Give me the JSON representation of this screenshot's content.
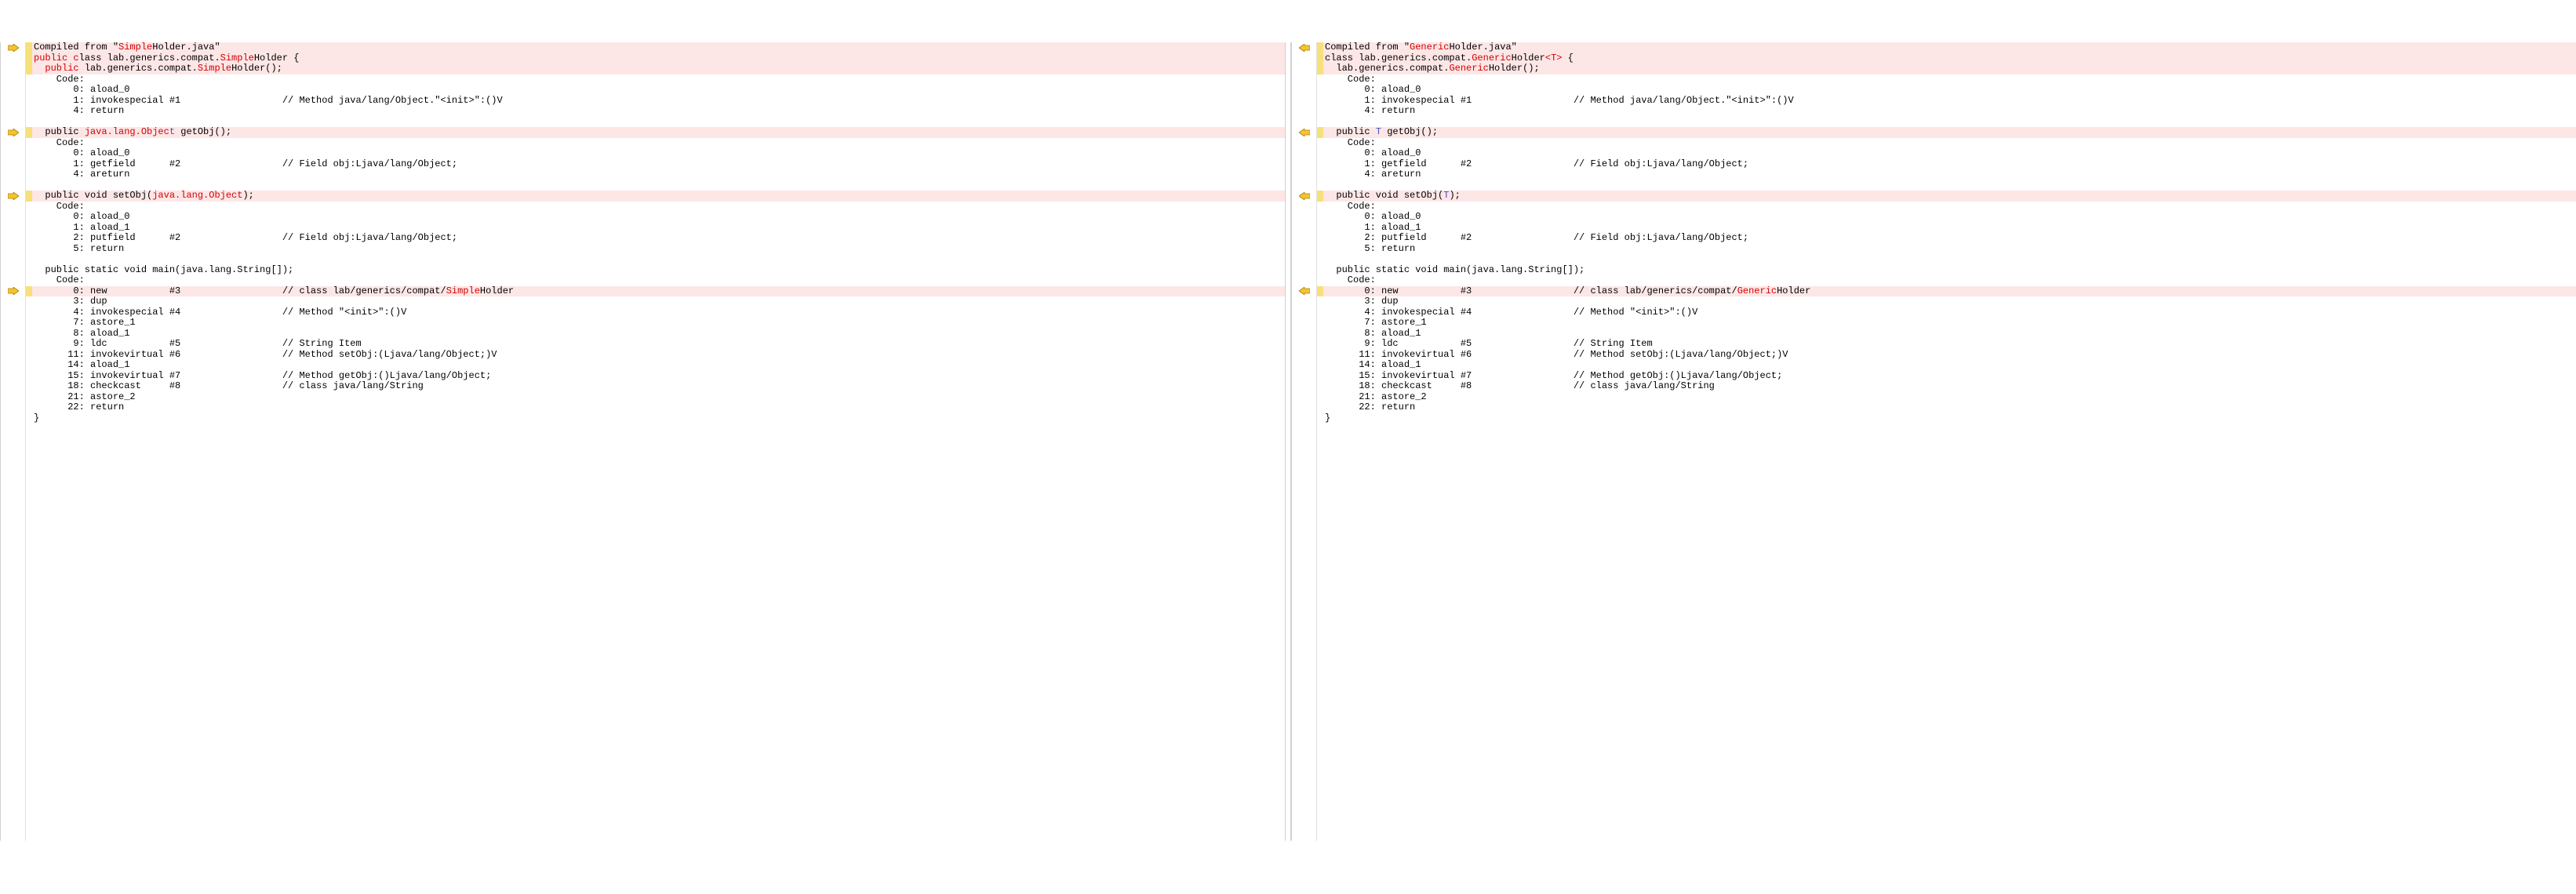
{
  "left": {
    "lines": [
      {
        "changed": true,
        "arrow": "right",
        "tokens": [
          [
            "",
            "Compiled from \""
          ],
          [
            "diff",
            "Simple"
          ],
          [
            "",
            "Holder.java\""
          ]
        ]
      },
      {
        "changed": true,
        "arrow": "",
        "tokens": [
          [
            "diff",
            "public c"
          ],
          [
            "",
            "lass lab.generics.compat."
          ],
          [
            "diff",
            "Simple"
          ],
          [
            "",
            "Holder {"
          ]
        ]
      },
      {
        "changed": true,
        "arrow": "",
        "tokens": [
          [
            "",
            "  "
          ],
          [
            "diff",
            "public "
          ],
          [
            "",
            "lab.generics.compat."
          ],
          [
            "diff",
            "Simple"
          ],
          [
            "",
            "Holder();"
          ]
        ]
      },
      {
        "changed": false,
        "arrow": "",
        "tokens": [
          [
            "",
            "    Code:"
          ]
        ]
      },
      {
        "changed": false,
        "arrow": "",
        "tokens": [
          [
            "",
            "       0: aload_0"
          ]
        ]
      },
      {
        "changed": false,
        "arrow": "",
        "tokens": [
          [
            "",
            "       1: invokespecial #1                  // Method java/lang/Object.\"<init>\":()V"
          ]
        ]
      },
      {
        "changed": false,
        "arrow": "",
        "tokens": [
          [
            "",
            "       4: return"
          ]
        ]
      },
      {
        "changed": false,
        "arrow": "",
        "tokens": [
          [
            "",
            ""
          ]
        ]
      },
      {
        "changed": true,
        "arrow": "right",
        "tokens": [
          [
            "",
            "  public "
          ],
          [
            "diff",
            "java.lang.Objec"
          ],
          [
            "kw",
            "t"
          ],
          [
            "",
            " getObj();"
          ]
        ]
      },
      {
        "changed": false,
        "arrow": "",
        "tokens": [
          [
            "",
            "    Code:"
          ]
        ]
      },
      {
        "changed": false,
        "arrow": "",
        "tokens": [
          [
            "",
            "       0: aload_0"
          ]
        ]
      },
      {
        "changed": false,
        "arrow": "",
        "tokens": [
          [
            "",
            "       1: getfield      #2                  // Field obj:Ljava/lang/Object;"
          ]
        ]
      },
      {
        "changed": false,
        "arrow": "",
        "tokens": [
          [
            "",
            "       4: areturn"
          ]
        ]
      },
      {
        "changed": false,
        "arrow": "",
        "tokens": [
          [
            "",
            ""
          ]
        ]
      },
      {
        "changed": true,
        "arrow": "right",
        "tokens": [
          [
            "",
            "  public void setObj("
          ],
          [
            "diff",
            "java.lang.Object"
          ],
          [
            "",
            ");"
          ]
        ]
      },
      {
        "changed": false,
        "arrow": "",
        "tokens": [
          [
            "",
            "    Code:"
          ]
        ]
      },
      {
        "changed": false,
        "arrow": "",
        "tokens": [
          [
            "",
            "       0: aload_0"
          ]
        ]
      },
      {
        "changed": false,
        "arrow": "",
        "tokens": [
          [
            "",
            "       1: aload_1"
          ]
        ]
      },
      {
        "changed": false,
        "arrow": "",
        "tokens": [
          [
            "",
            "       2: putfield      #2                  // Field obj:Ljava/lang/Object;"
          ]
        ]
      },
      {
        "changed": false,
        "arrow": "",
        "tokens": [
          [
            "",
            "       5: return"
          ]
        ]
      },
      {
        "changed": false,
        "arrow": "",
        "tokens": [
          [
            "",
            ""
          ]
        ]
      },
      {
        "changed": false,
        "arrow": "",
        "tokens": [
          [
            "",
            "  public static void main(java.lang.String[]);"
          ]
        ]
      },
      {
        "changed": false,
        "arrow": "",
        "tokens": [
          [
            "",
            "    Code:"
          ]
        ]
      },
      {
        "changed": true,
        "arrow": "right",
        "tokens": [
          [
            "",
            "       0: new           #3                  // class lab/generics/compat/"
          ],
          [
            "diff",
            "Simple"
          ],
          [
            "",
            "Holder"
          ]
        ]
      },
      {
        "changed": false,
        "arrow": "",
        "tokens": [
          [
            "",
            "       3: dup"
          ]
        ]
      },
      {
        "changed": false,
        "arrow": "",
        "tokens": [
          [
            "",
            "       4: invokespecial #4                  // Method \"<init>\":()V"
          ]
        ]
      },
      {
        "changed": false,
        "arrow": "",
        "tokens": [
          [
            "",
            "       7: astore_1"
          ]
        ]
      },
      {
        "changed": false,
        "arrow": "",
        "tokens": [
          [
            "",
            "       8: aload_1"
          ]
        ]
      },
      {
        "changed": false,
        "arrow": "",
        "tokens": [
          [
            "",
            "       9: ldc           #5                  // String Item"
          ]
        ]
      },
      {
        "changed": false,
        "arrow": "",
        "tokens": [
          [
            "",
            "      11: invokevirtual #6                  // Method setObj:(Ljava/lang/Object;)V"
          ]
        ]
      },
      {
        "changed": false,
        "arrow": "",
        "tokens": [
          [
            "",
            "      14: aload_1"
          ]
        ]
      },
      {
        "changed": false,
        "arrow": "",
        "tokens": [
          [
            "",
            "      15: invokevirtual #7                  // Method getObj:()Ljava/lang/Object;"
          ]
        ]
      },
      {
        "changed": false,
        "arrow": "",
        "tokens": [
          [
            "",
            "      18: checkcast     #8                  // class java/lang/String"
          ]
        ]
      },
      {
        "changed": false,
        "arrow": "",
        "tokens": [
          [
            "",
            "      21: astore_2"
          ]
        ]
      },
      {
        "changed": false,
        "arrow": "",
        "tokens": [
          [
            "",
            "      22: return"
          ]
        ]
      },
      {
        "changed": false,
        "arrow": "",
        "tokens": [
          [
            "",
            "}"
          ]
        ]
      }
    ]
  },
  "right": {
    "lines": [
      {
        "changed": true,
        "arrow": "left",
        "tokens": [
          [
            "",
            "Compiled from \""
          ],
          [
            "diff",
            "Generic"
          ],
          [
            "",
            "Holder.java\""
          ]
        ]
      },
      {
        "changed": true,
        "arrow": "",
        "tokens": [
          [
            "",
            "class lab.generics.compat."
          ],
          [
            "diff",
            "Generic"
          ],
          [
            "",
            "Holder"
          ],
          [
            "diff",
            "<T>"
          ],
          [
            "",
            " {"
          ]
        ]
      },
      {
        "changed": true,
        "arrow": "",
        "tokens": [
          [
            "",
            "  lab.generics.compat."
          ],
          [
            "diff",
            "Generic"
          ],
          [
            "",
            "Holder();"
          ]
        ]
      },
      {
        "changed": false,
        "arrow": "",
        "tokens": [
          [
            "",
            "    Code:"
          ]
        ]
      },
      {
        "changed": false,
        "arrow": "",
        "tokens": [
          [
            "",
            "       0: aload_0"
          ]
        ]
      },
      {
        "changed": false,
        "arrow": "",
        "tokens": [
          [
            "",
            "       1: invokespecial #1                  // Method java/lang/Object.\"<init>\":()V"
          ]
        ]
      },
      {
        "changed": false,
        "arrow": "",
        "tokens": [
          [
            "",
            "       4: return"
          ]
        ]
      },
      {
        "changed": false,
        "arrow": "",
        "tokens": [
          [
            "",
            ""
          ]
        ]
      },
      {
        "changed": true,
        "arrow": "left",
        "tokens": [
          [
            "",
            "  public "
          ],
          [
            "kw",
            "T"
          ],
          [
            "",
            " getObj();"
          ]
        ]
      },
      {
        "changed": false,
        "arrow": "",
        "tokens": [
          [
            "",
            "    Code:"
          ]
        ]
      },
      {
        "changed": false,
        "arrow": "",
        "tokens": [
          [
            "",
            "       0: aload_0"
          ]
        ]
      },
      {
        "changed": false,
        "arrow": "",
        "tokens": [
          [
            "",
            "       1: getfield      #2                  // Field obj:Ljava/lang/Object;"
          ]
        ]
      },
      {
        "changed": false,
        "arrow": "",
        "tokens": [
          [
            "",
            "       4: areturn"
          ]
        ]
      },
      {
        "changed": false,
        "arrow": "",
        "tokens": [
          [
            "",
            ""
          ]
        ]
      },
      {
        "changed": true,
        "arrow": "left",
        "tokens": [
          [
            "",
            "  public void setObj("
          ],
          [
            "kw",
            "T"
          ],
          [
            "",
            ");"
          ]
        ]
      },
      {
        "changed": false,
        "arrow": "",
        "tokens": [
          [
            "",
            "    Code:"
          ]
        ]
      },
      {
        "changed": false,
        "arrow": "",
        "tokens": [
          [
            "",
            "       0: aload_0"
          ]
        ]
      },
      {
        "changed": false,
        "arrow": "",
        "tokens": [
          [
            "",
            "       1: aload_1"
          ]
        ]
      },
      {
        "changed": false,
        "arrow": "",
        "tokens": [
          [
            "",
            "       2: putfield      #2                  // Field obj:Ljava/lang/Object;"
          ]
        ]
      },
      {
        "changed": false,
        "arrow": "",
        "tokens": [
          [
            "",
            "       5: return"
          ]
        ]
      },
      {
        "changed": false,
        "arrow": "",
        "tokens": [
          [
            "",
            ""
          ]
        ]
      },
      {
        "changed": false,
        "arrow": "",
        "tokens": [
          [
            "",
            "  public static void main(java.lang.String[]);"
          ]
        ]
      },
      {
        "changed": false,
        "arrow": "",
        "tokens": [
          [
            "",
            "    Code:"
          ]
        ]
      },
      {
        "changed": true,
        "arrow": "left",
        "tokens": [
          [
            "",
            "       0: new           #3                  // class lab/generics/compat/"
          ],
          [
            "diff",
            "Generic"
          ],
          [
            "",
            "Holder"
          ]
        ]
      },
      {
        "changed": false,
        "arrow": "",
        "tokens": [
          [
            "",
            "       3: dup"
          ]
        ]
      },
      {
        "changed": false,
        "arrow": "",
        "tokens": [
          [
            "",
            "       4: invokespecial #4                  // Method \"<init>\":()V"
          ]
        ]
      },
      {
        "changed": false,
        "arrow": "",
        "tokens": [
          [
            "",
            "       7: astore_1"
          ]
        ]
      },
      {
        "changed": false,
        "arrow": "",
        "tokens": [
          [
            "",
            "       8: aload_1"
          ]
        ]
      },
      {
        "changed": false,
        "arrow": "",
        "tokens": [
          [
            "",
            "       9: ldc           #5                  // String Item"
          ]
        ]
      },
      {
        "changed": false,
        "arrow": "",
        "tokens": [
          [
            "",
            "      11: invokevirtual #6                  // Method setObj:(Ljava/lang/Object;)V"
          ]
        ]
      },
      {
        "changed": false,
        "arrow": "",
        "tokens": [
          [
            "",
            "      14: aload_1"
          ]
        ]
      },
      {
        "changed": false,
        "arrow": "",
        "tokens": [
          [
            "",
            "      15: invokevirtual #7                  // Method getObj:()Ljava/lang/Object;"
          ]
        ]
      },
      {
        "changed": false,
        "arrow": "",
        "tokens": [
          [
            "",
            "      18: checkcast     #8                  // class java/lang/String"
          ]
        ]
      },
      {
        "changed": false,
        "arrow": "",
        "tokens": [
          [
            "",
            "      21: astore_2"
          ]
        ]
      },
      {
        "changed": false,
        "arrow": "",
        "tokens": [
          [
            "",
            "      22: return"
          ]
        ]
      },
      {
        "changed": false,
        "arrow": "",
        "tokens": [
          [
            "",
            "}"
          ]
        ]
      }
    ]
  }
}
